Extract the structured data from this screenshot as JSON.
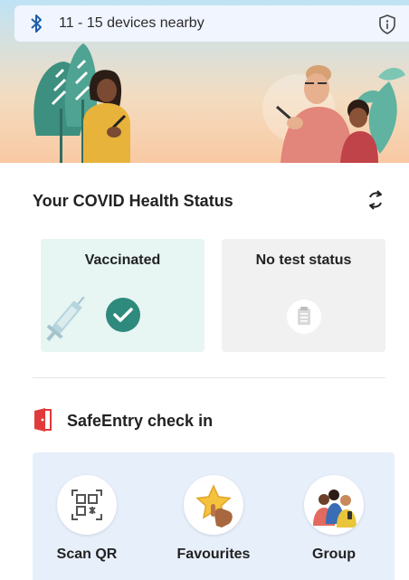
{
  "bluetooth": {
    "icon": "bluetooth-icon",
    "nearby_text": "11 - 15 devices nearby",
    "info_icon": "shield-info-icon"
  },
  "health": {
    "title": "Your COVID Health Status",
    "refresh_icon": "refresh-icon",
    "cards": [
      {
        "label": "Vaccinated",
        "icon": "check-circle-icon",
        "accent": "#2d8a7c"
      },
      {
        "label": "No test status",
        "icon": "clipboard-icon"
      }
    ]
  },
  "safeentry": {
    "title": "SafeEntry check in",
    "icon": "door-checkin-icon",
    "accent": "#e23a3a",
    "actions": [
      {
        "label": "Scan QR",
        "icon": "qr-scan-icon"
      },
      {
        "label": "Favourites",
        "icon": "star-icon"
      },
      {
        "label": "Group",
        "icon": "group-icon"
      }
    ]
  },
  "colors": {
    "card_vaccinated_bg": "#e7f5f3",
    "card_test_bg": "#f1f1f1",
    "actions_bg": "#e7effb"
  }
}
